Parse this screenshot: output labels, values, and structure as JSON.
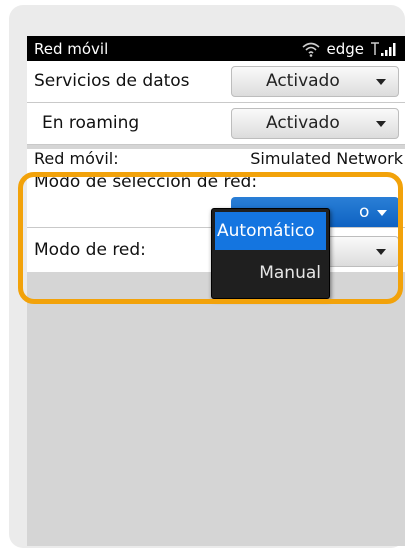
{
  "statusbar": {
    "title": "Red móvil",
    "network": "edge"
  },
  "rows": [
    {
      "label": "Servicios de datos",
      "value": "Activado"
    },
    {
      "label": "En roaming",
      "value": "Activado"
    }
  ],
  "info": {
    "label": "Red móvil:",
    "value": "Simulated Network"
  },
  "network_selection": {
    "label": "Modo de selección de red:",
    "value_partial": "o"
  },
  "network_mode": {
    "label": "Modo de red:"
  },
  "popup": {
    "options": [
      "Automático",
      "Manual"
    ],
    "selected": "Automático"
  },
  "colors": {
    "highlight": "#f2a20a",
    "selection": "#1475e0"
  }
}
